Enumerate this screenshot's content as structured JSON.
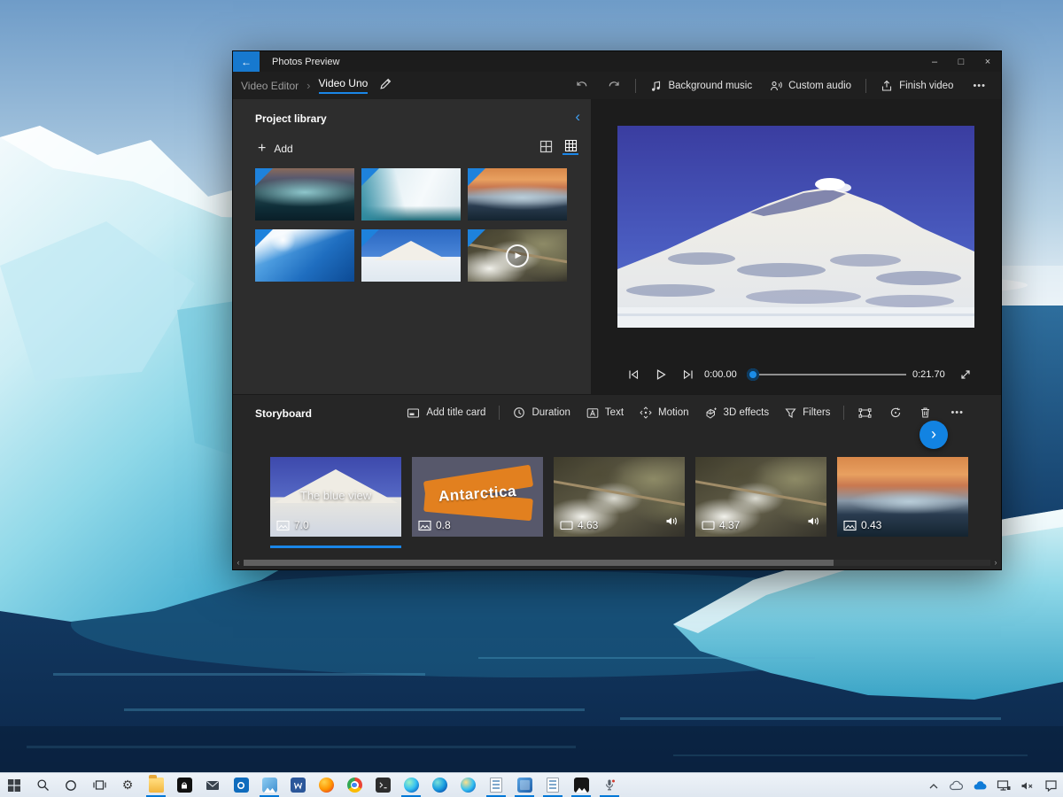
{
  "glyphs": {
    "back": "←",
    "minimize": "–",
    "maximize": "□",
    "close": "×",
    "breadcrumb_separator": "›",
    "collapse_panel": "‹",
    "add_plus": "+",
    "ellipsis": "•••",
    "play_overlay": "▶",
    "next_chevron": "›",
    "scroll_left": "‹",
    "scroll_right": "›",
    "gear": "⚙"
  },
  "window": {
    "app_title": "Photos Preview"
  },
  "breadcrumb": {
    "parent": "Video Editor",
    "current": "Video Uno"
  },
  "top_toolbar": {
    "background_music": "Background music",
    "custom_audio": "Custom audio",
    "finish_video": "Finish video"
  },
  "project_library": {
    "title": "Project library",
    "add_label": "Add"
  },
  "player": {
    "current_time": "0:00.00",
    "total_time": "0:21.70"
  },
  "storyboard": {
    "title": "Storyboard",
    "add_title_card": "Add title card",
    "tools": [
      {
        "label": "Duration"
      },
      {
        "label": "Text"
      },
      {
        "label": "Motion"
      },
      {
        "label": "3D effects"
      },
      {
        "label": "Filters"
      }
    ],
    "clips": [
      {
        "title": "The blue view",
        "duration": "7.0",
        "type": "image",
        "selected": true,
        "audio": false
      },
      {
        "title": "Antarctica",
        "duration": "0.8",
        "type": "image",
        "selected": false,
        "audio": false
      },
      {
        "title": "",
        "duration": "4.63",
        "type": "video",
        "selected": false,
        "audio": true
      },
      {
        "title": "",
        "duration": "4.37",
        "type": "video",
        "selected": false,
        "audio": true
      },
      {
        "title": "",
        "duration": "0.43",
        "type": "image",
        "selected": false,
        "audio": false
      }
    ]
  },
  "colors": {
    "accent": "#0078d7",
    "selection_blue": "#1a86e8",
    "window_bg": "#1f1f1f",
    "library_panel_bg": "#2d2d2d",
    "storyboard_bg": "#262626",
    "taskbar_bg": "#e7edf4"
  }
}
